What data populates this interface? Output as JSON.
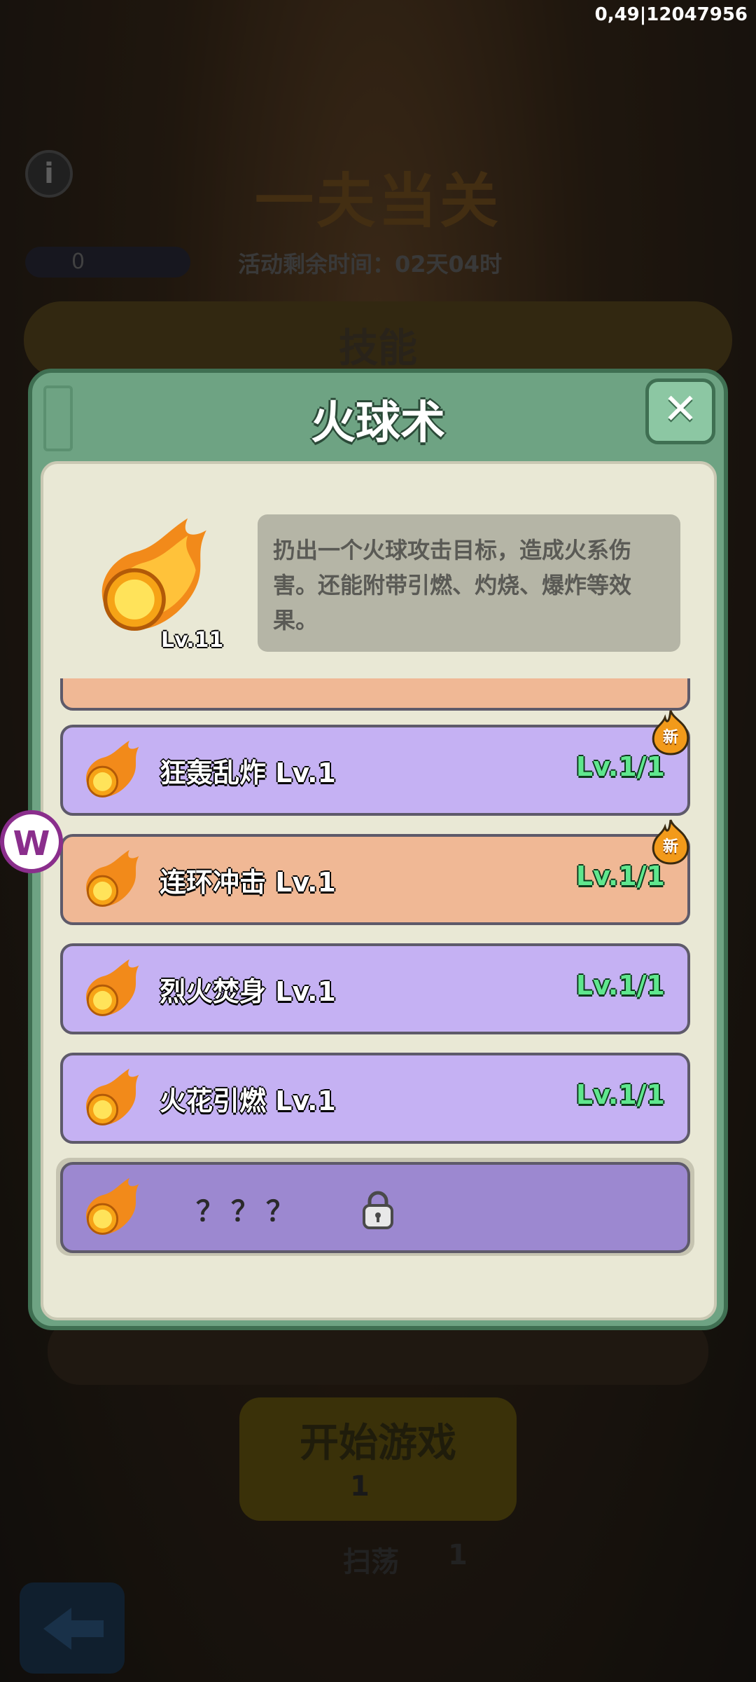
{
  "debug_overlay": "0,49|12047956",
  "background": {
    "event_title": "一夫当关",
    "ticket_count": "0",
    "timer_text": "活动剩余时间：02天04时",
    "scroll_title": "技能",
    "start_button": "开始游戏",
    "start_cost": "1",
    "sweep_label": "扫荡",
    "sweep_count": "1"
  },
  "dialog": {
    "title": "火球术",
    "skill_level": "Lv.11",
    "description": "扔出一个火球攻击目标，造成火系伤害。还能附带引燃、灼烧、爆炸等效果。",
    "rows": [
      {
        "name": "狂轰乱炸 Lv.1",
        "level": "Lv.1/1",
        "is_new": true,
        "badge": "新"
      },
      {
        "name": "连环冲击 Lv.1",
        "level": "Lv.1/1",
        "is_new": true,
        "badge": "新"
      },
      {
        "name": "烈火焚身 Lv.1",
        "level": "Lv.1/1"
      },
      {
        "name": "火花引燃 Lv.1",
        "level": "Lv.1/1"
      },
      {
        "name": "？？？",
        "locked": true
      }
    ]
  },
  "icons": {
    "fireball": "fireball-icon",
    "lock": "lock-icon",
    "close": "close-icon",
    "new_badge": "flame-badge-icon",
    "info": "info-icon"
  },
  "colors": {
    "dialog_green": "#6ea383",
    "row_purple": "#c5b1f3",
    "row_orange": "#f0b895",
    "level_green": "#5fe78e"
  }
}
